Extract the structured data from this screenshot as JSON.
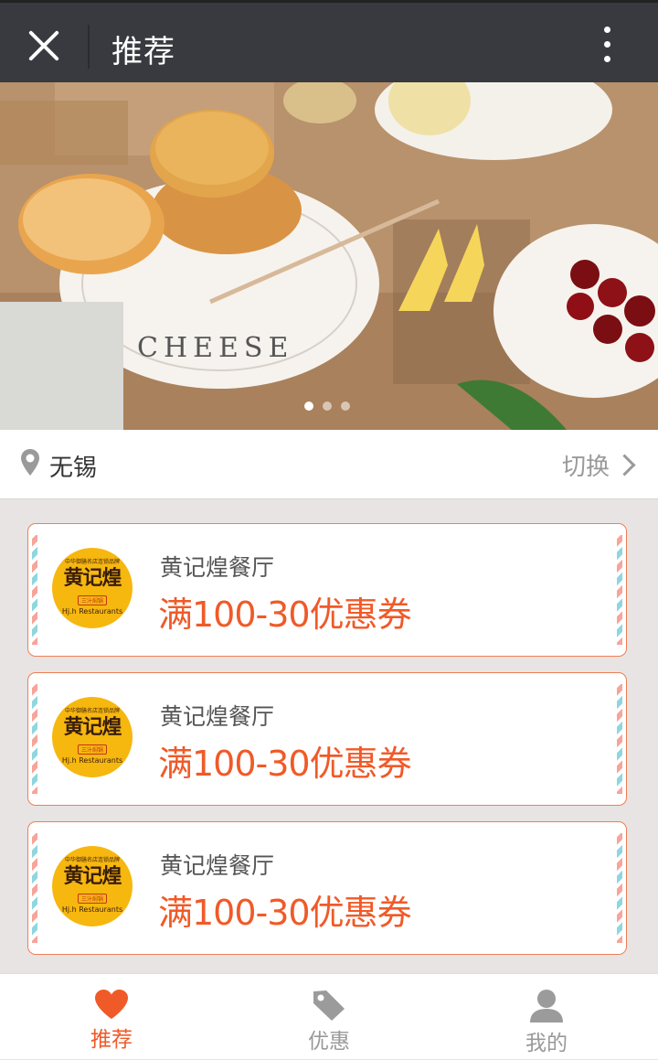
{
  "topbar": {
    "title": "推荐"
  },
  "location": {
    "city": "无锡",
    "switch_label": "切换"
  },
  "coupons": [
    {
      "logo_name": "黄记煌",
      "logo_tag": "三汁焖锅",
      "logo_en": "Hj.h Restaurants",
      "logo_slogan": "中华御膳名店连锁品牌",
      "shop": "黄记煌餐厅",
      "offer": "满100-30优惠券"
    },
    {
      "logo_name": "黄记煌",
      "logo_tag": "三汁焖锅",
      "logo_en": "Hj.h Restaurants",
      "logo_slogan": "中华御膳名店连锁品牌",
      "shop": "黄记煌餐厅",
      "offer": "满100-30优惠券"
    },
    {
      "logo_name": "黄记煌",
      "logo_tag": "三汁焖锅",
      "logo_en": "Hj.h Restaurants",
      "logo_slogan": "中华御膳名店连锁品牌",
      "shop": "黄记煌餐厅",
      "offer": "满100-30优惠券"
    }
  ],
  "tabs": [
    {
      "label": "推荐",
      "icon": "heart-icon",
      "active": true
    },
    {
      "label": "优惠",
      "icon": "tag-icon",
      "active": false
    },
    {
      "label": "我的",
      "icon": "user-icon",
      "active": false
    }
  ],
  "colors": {
    "accent": "#f05a28",
    "topbar": "#393a3f",
    "coupon_border": "#f07e55",
    "logo": "#f6b70f"
  }
}
